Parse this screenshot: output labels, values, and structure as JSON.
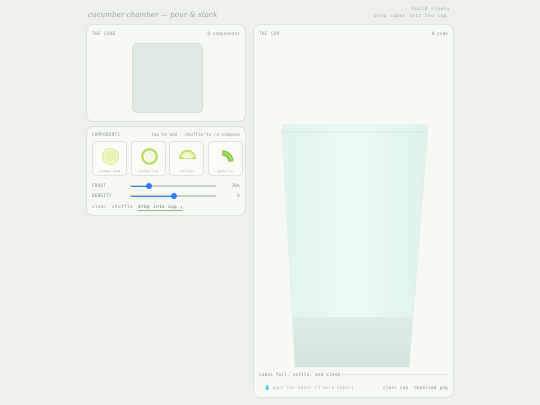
{
  "app": {
    "brand": "cucumber chamber — pour & stack",
    "tagline_line1": "build slowly",
    "tagline_line2": "drop cubes into the cup."
  },
  "cube_panel": {
    "title": "THE CUBE",
    "count": "0 components"
  },
  "components": {
    "title": "COMPONENTS",
    "hint": "tap to add · shuffle to re-compose",
    "items": [
      {
        "label": "cucumber round",
        "icon": "solid-disc-icon"
      },
      {
        "label": "cucumber ring",
        "icon": "ring-icon"
      },
      {
        "label": "half moon",
        "icon": "half-moon-icon"
      },
      {
        "label": "quarter arc",
        "icon": "quarter-arc-icon"
      }
    ],
    "sliders": [
      {
        "name": "FROST",
        "value_text": "30%",
        "level": 0.21
      },
      {
        "name": "DENSITY",
        "value_text": "6",
        "level": 0.51
      }
    ],
    "actions": {
      "clear": "clear",
      "shuffle": "shuffle",
      "drop": "drop into cup ↓"
    }
  },
  "cup_panel": {
    "title": "THE CUP",
    "count": "0 cube",
    "status": "cubes fall, settle, and sleep",
    "pour_label": "pour the water (3 more cubes)",
    "clear_cup": "clear cup",
    "download": "download png"
  },
  "colors": {
    "background": "#edf1e9",
    "accent": "#2f7cf6",
    "cucumber_green": "#b6dc5c",
    "water": "#e6f7f2"
  }
}
